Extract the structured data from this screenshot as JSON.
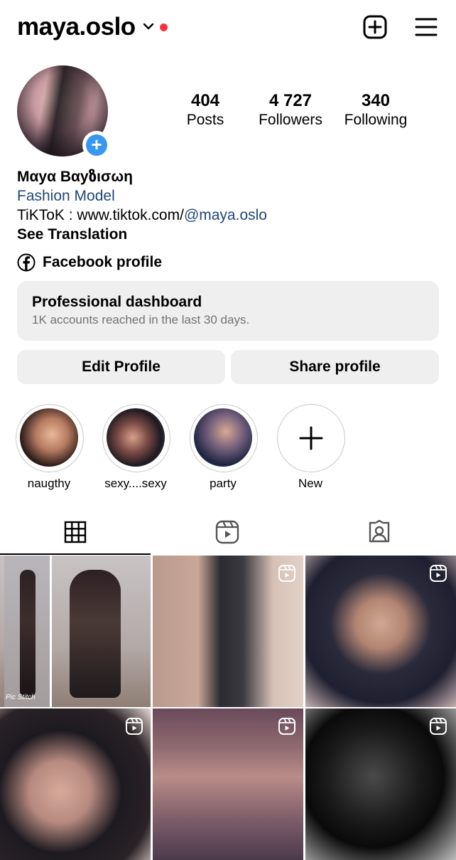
{
  "header": {
    "username": "maya.oslo",
    "icons": [
      "chevron-down-icon",
      "notification-dot",
      "new-post-icon",
      "menu-icon"
    ]
  },
  "stats": [
    {
      "value": "404",
      "label": "Posts"
    },
    {
      "value": "4 727",
      "label": "Followers"
    },
    {
      "value": "340",
      "label": "Following"
    }
  ],
  "bio": {
    "name": "Mαyα Bαyზισωη",
    "category": "Fashion Model",
    "link_prefix": "TiKToK : www.tiktok.com/",
    "link_mention": "@maya.oslo",
    "translate": "See Translation",
    "facebook": "Facebook profile"
  },
  "dashboard": {
    "title": "Professional dashboard",
    "subtitle": "1K accounts reached in the last 30 days."
  },
  "buttons": {
    "edit": "Edit Profile",
    "share": "Share profile"
  },
  "highlights": [
    {
      "label": "naugthy"
    },
    {
      "label": "sexy....sexy"
    },
    {
      "label": "party"
    },
    {
      "label": "New"
    }
  ],
  "tabs": [
    "grid-icon",
    "reels-icon",
    "tagged-icon"
  ],
  "grid": {
    "watermark": "Pic Stitch"
  },
  "colors": {
    "accent_link": "#21477a",
    "badge_blue": "#3897f0",
    "notification_red": "#ff3040",
    "surface": "#efefef"
  }
}
